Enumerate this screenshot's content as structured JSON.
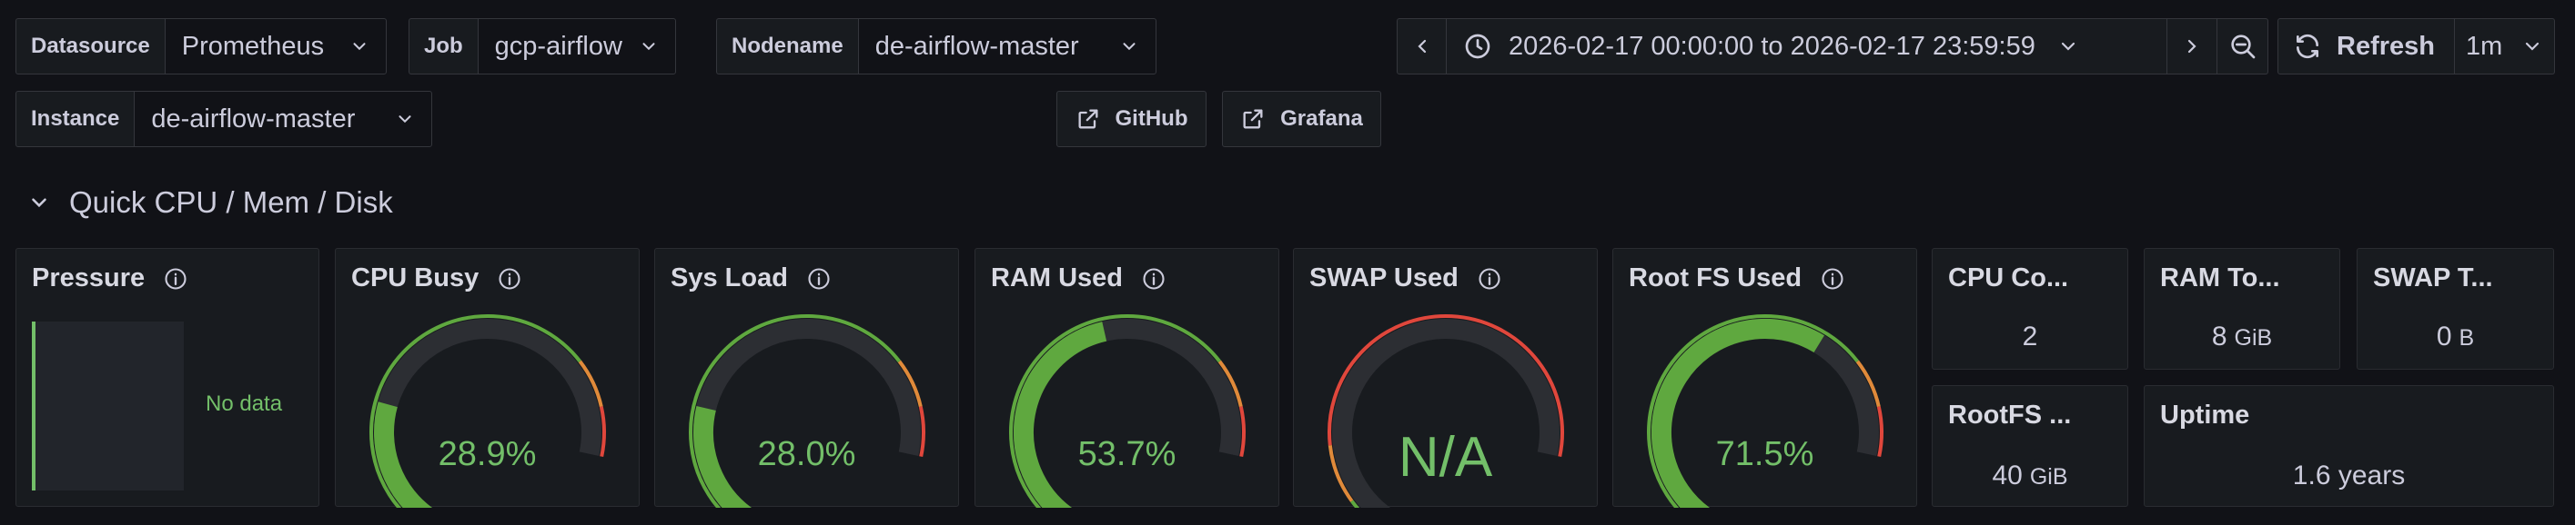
{
  "variables": [
    {
      "label": "Datasource",
      "value": "Prometheus"
    },
    {
      "label": "Job",
      "value": "gcp-airflow"
    },
    {
      "label": "Nodename",
      "value": "de-airflow-master"
    },
    {
      "label": "Instance",
      "value": "de-airflow-master"
    }
  ],
  "links": [
    {
      "label": "GitHub",
      "icon": "external-link-icon"
    },
    {
      "label": "Grafana",
      "icon": "external-link-icon"
    }
  ],
  "timepicker": {
    "range": "2026-02-17 00:00:00 to 2026-02-17 23:59:59",
    "refresh_label": "Refresh",
    "refresh_interval": "1m"
  },
  "row": {
    "title": "Quick CPU / Mem / Disk"
  },
  "panels": {
    "pressure": {
      "title": "Pressure",
      "no_data": "No data"
    },
    "cpu_busy": {
      "title": "CPU Busy",
      "value": "28.9%",
      "fraction": 0.289
    },
    "sys_load": {
      "title": "Sys Load",
      "value": "28.0%",
      "fraction": 0.28
    },
    "ram_used": {
      "title": "RAM Used",
      "value": "53.7%",
      "fraction": 0.537
    },
    "swap_used": {
      "title": "SWAP Used",
      "value": "N/A",
      "fraction": 0
    },
    "root_fs_used": {
      "title": "Root FS Used",
      "value": "71.5%",
      "fraction": 0.715
    },
    "cpu_cores": {
      "title": "CPU Co...",
      "value": "2",
      "unit": ""
    },
    "ram_total": {
      "title": "RAM To...",
      "value": "8",
      "unit": "GiB"
    },
    "swap_total": {
      "title": "SWAP T...",
      "value": "0",
      "unit": "B"
    },
    "rootfs_total": {
      "title": "RootFS ...",
      "value": "40",
      "unit": "GiB"
    },
    "uptime": {
      "title": "Uptime",
      "value": "1.6 years"
    }
  },
  "colors": {
    "green": "#5fa83f",
    "green_text": "#73bf69",
    "red": "#e0473c",
    "orange": "#e08a3a",
    "track": "#2c2e33"
  }
}
